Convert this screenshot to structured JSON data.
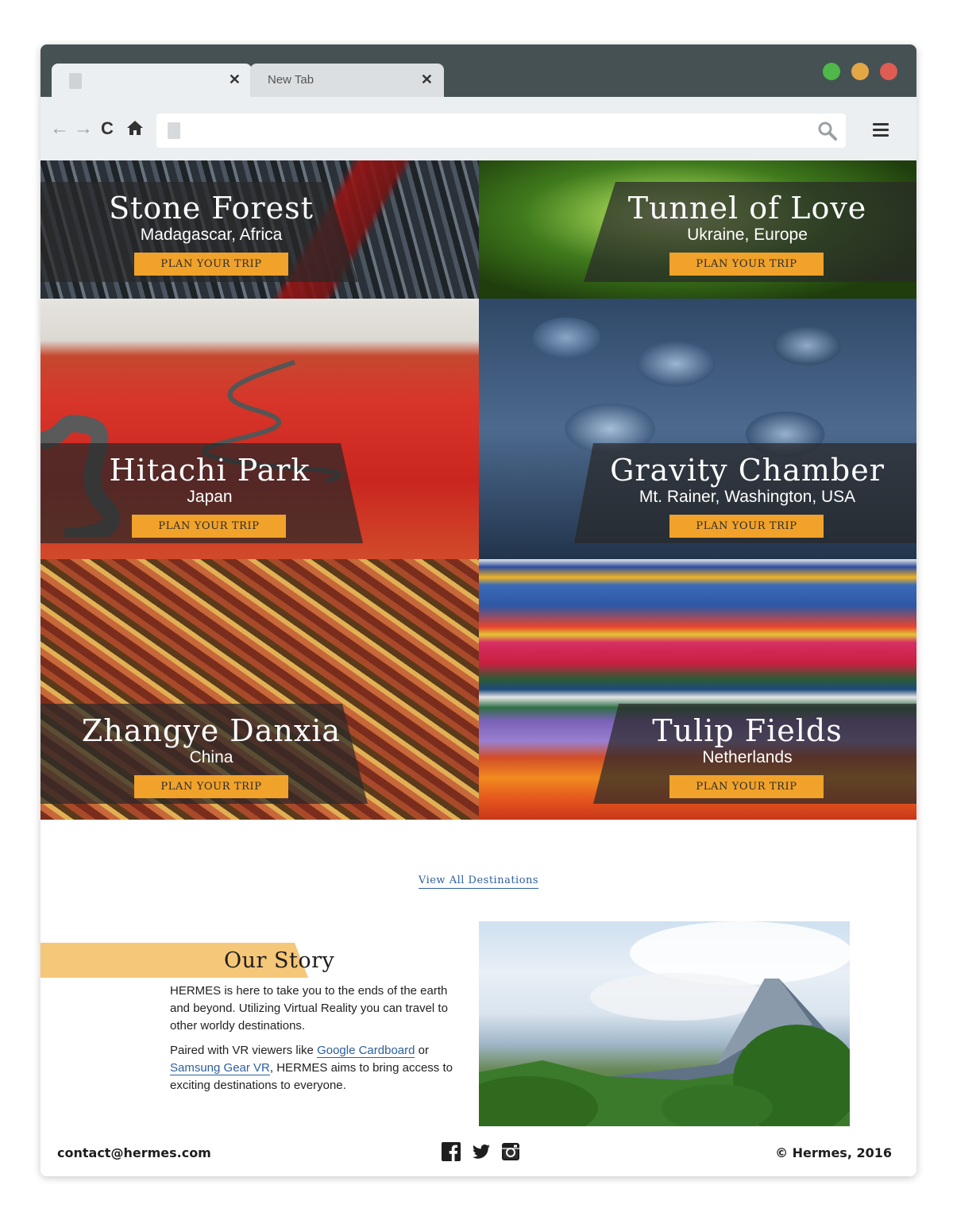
{
  "browser": {
    "tabs": [
      {
        "label": ""
      },
      {
        "label": "New Tab"
      }
    ],
    "close_glyph": "✕",
    "window_controls": [
      "#4fb848",
      "#e2a845",
      "#de5c52"
    ],
    "url": "",
    "icons": [
      "back-arrow-icon",
      "forward-arrow-icon",
      "reload-icon",
      "home-icon",
      "search-icon",
      "hamburger-menu-icon"
    ]
  },
  "destinations": [
    {
      "name": "Stone Forest",
      "location": "Madagascar, Africa",
      "button": "PLAN YOUR TRIP"
    },
    {
      "name": "Tunnel of Love",
      "location": "Ukraine, Europe",
      "button": "PLAN YOUR TRIP"
    },
    {
      "name": "Hitachi Park",
      "location": "Japan",
      "button": "PLAN YOUR TRIP"
    },
    {
      "name": "Gravity Chamber",
      "location": "Mt. Rainer, Washington, USA",
      "button": "PLAN YOUR TRIP"
    },
    {
      "name": "Zhangye Danxia",
      "location": "China",
      "button": "PLAN YOUR TRIP"
    },
    {
      "name": "Tulip Fields",
      "location": "Netherlands",
      "button": "PLAN YOUR TRIP"
    }
  ],
  "view_all": "View All Destinations",
  "story": {
    "title": "Our Story",
    "p1": "HERMES is here to take you to the ends of the earth and beyond. Utilizing Virtual Reality you can travel to other worldy destinations.",
    "p2_pre": "Paired with VR viewers like ",
    "link1": "Google Cardboard",
    "p2_mid": " or ",
    "link2": "Samsung Gear VR",
    "p2_post": ", HERMES aims to bring access to exciting destinations to everyone."
  },
  "footer": {
    "email": "contact@hermes.com",
    "copyright": "© Hermes, 2016",
    "social_icons": [
      "facebook-icon",
      "twitter-icon",
      "instagram-icon"
    ]
  },
  "colors": {
    "accent": "#f1a22a",
    "banner": "#f5c778",
    "link": "#2c5f9e",
    "chrome": "#465154"
  }
}
